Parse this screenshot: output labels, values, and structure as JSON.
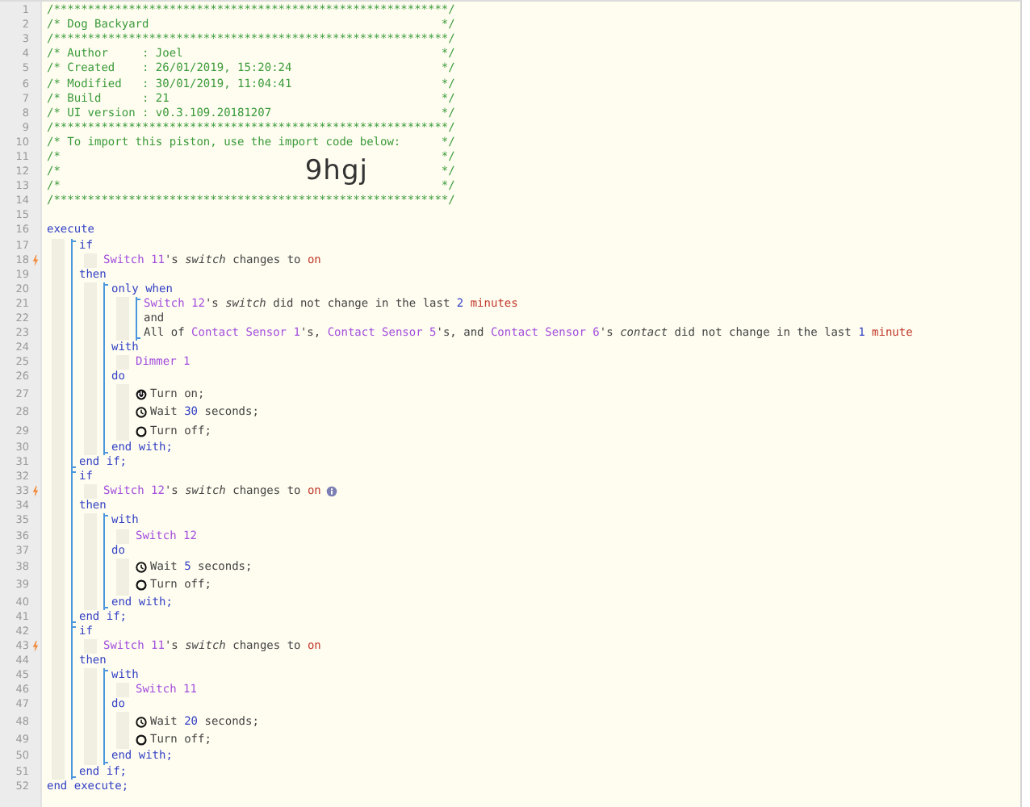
{
  "lines": [
    {
      "number": "1",
      "tokens": [
        {
          "kind": "comment",
          "text": "/**********************************************************/"
        }
      ]
    },
    {
      "number": "2",
      "tokens": [
        {
          "kind": "comment",
          "text": "/* Dog Backyard"
        },
        {
          "kind": "comment",
          "text": " */"
        }
      ]
    },
    {
      "number": "3",
      "tokens": [
        {
          "kind": "comment",
          "text": "/**********************************************************/"
        }
      ]
    },
    {
      "number": "4",
      "tokens": [
        {
          "kind": "comment",
          "text": "/* Author     : Joel"
        },
        {
          "kind": "comment",
          "text": " */"
        }
      ]
    },
    {
      "number": "5",
      "tokens": [
        {
          "kind": "comment",
          "text": "/* Created    : 26/01/2019, 15:20:24"
        },
        {
          "kind": "comment",
          "text": " */"
        }
      ]
    },
    {
      "number": "6",
      "tokens": [
        {
          "kind": "comment",
          "text": "/* Modified   : 30/01/2019, 11:04:41"
        },
        {
          "kind": "comment",
          "text": " */"
        }
      ]
    },
    {
      "number": "7",
      "tokens": [
        {
          "kind": "comment",
          "text": "/* Build      : 21"
        },
        {
          "kind": "comment",
          "text": " */"
        }
      ]
    },
    {
      "number": "8",
      "tokens": [
        {
          "kind": "comment",
          "text": "/* UI version : v0.3.109.20181207"
        },
        {
          "kind": "comment",
          "text": " */"
        }
      ]
    },
    {
      "number": "9",
      "tokens": [
        {
          "kind": "comment",
          "text": "/**********************************************************/"
        }
      ]
    },
    {
      "number": "10",
      "tokens": [
        {
          "kind": "comment",
          "text": "/* To import this piston, use the import code below:"
        },
        {
          "kind": "comment",
          "text": " */"
        }
      ]
    },
    {
      "number": "11",
      "tokens": [
        {
          "kind": "comment",
          "text": "/*"
        },
        {
          "kind": "comment",
          "text": " */"
        }
      ]
    },
    {
      "number": "12",
      "tokens": [
        {
          "kind": "comment",
          "text": "/*"
        },
        {
          "kind": "import_code",
          "text": "9hgj"
        },
        {
          "kind": "comment",
          "text": " */"
        }
      ]
    },
    {
      "number": "13",
      "tokens": [
        {
          "kind": "comment",
          "text": "/*"
        },
        {
          "kind": "comment",
          "text": " */"
        }
      ]
    },
    {
      "number": "14",
      "tokens": [
        {
          "kind": "comment",
          "text": "/**********************************************************/"
        }
      ]
    },
    {
      "number": "15"
    },
    {
      "number": "16",
      "tokens": [
        {
          "kind": "keyword",
          "text": "execute"
        }
      ],
      "children": [
        {
          "kind": "block",
          "items": [
            {
              "number": "17",
              "tokens": [
                {
                  "kind": "keyword",
                  "text": "if"
                }
              ],
              "children": [
                {
                  "number": "18",
                  "trigger": true,
                  "tokens": [
                    {
                      "kind": "device",
                      "text": "Switch 11"
                    },
                    {
                      "kind": "text",
                      "text": "'s "
                    },
                    {
                      "kind": "attribute",
                      "text": "switch"
                    },
                    {
                      "kind": "text",
                      "text": " changes to "
                    },
                    {
                      "kind": "value",
                      "text": "on"
                    }
                  ]
                }
              ]
            },
            {
              "number": "19",
              "tokens": [
                {
                  "kind": "keyword",
                  "text": "then"
                }
              ],
              "children": [
                {
                  "kind": "block",
                  "items": [
                    {
                      "number": "20",
                      "tokens": [
                        {
                          "kind": "keyword",
                          "text": "only when"
                        }
                      ],
                      "children": [
                        {
                          "kind": "block",
                          "items": [
                            {
                              "number": "21",
                              "tokens": [
                                {
                                  "kind": "device",
                                  "text": "Switch 12"
                                },
                                {
                                  "kind": "text",
                                  "text": "'s "
                                },
                                {
                                  "kind": "attribute",
                                  "text": "switch"
                                },
                                {
                                  "kind": "text",
                                  "text": " did not change in the last "
                                },
                                {
                                  "kind": "number",
                                  "text": "2"
                                },
                                {
                                  "kind": "value",
                                  "text": " minutes"
                                }
                              ]
                            },
                            {
                              "number": "22",
                              "tokens": [
                                {
                                  "kind": "text",
                                  "text": "and"
                                }
                              ]
                            },
                            {
                              "number": "23",
                              "tokens": [
                                {
                                  "kind": "text",
                                  "text": "All of "
                                },
                                {
                                  "kind": "device",
                                  "text": "Contact Sensor 1"
                                },
                                {
                                  "kind": "text",
                                  "text": "'s, "
                                },
                                {
                                  "kind": "device",
                                  "text": "Contact Sensor 5"
                                },
                                {
                                  "kind": "text",
                                  "text": "'s, and "
                                },
                                {
                                  "kind": "device",
                                  "text": "Contact Sensor 6"
                                },
                                {
                                  "kind": "text",
                                  "text": "'s "
                                },
                                {
                                  "kind": "attribute",
                                  "text": "contact"
                                },
                                {
                                  "kind": "text",
                                  "text": " did not change in the last "
                                },
                                {
                                  "kind": "number",
                                  "text": "1"
                                },
                                {
                                  "kind": "value",
                                  "text": " minute"
                                }
                              ]
                            }
                          ]
                        }
                      ]
                    },
                    {
                      "number": "24",
                      "tokens": [
                        {
                          "kind": "keyword",
                          "text": "with"
                        }
                      ],
                      "children": [
                        {
                          "number": "25",
                          "tokens": [
                            {
                              "kind": "device",
                              "text": "Dimmer 1"
                            }
                          ]
                        }
                      ]
                    },
                    {
                      "number": "26",
                      "tokens": [
                        {
                          "kind": "keyword",
                          "text": "do"
                        }
                      ],
                      "children": [
                        {
                          "number": "27",
                          "kind": "turn_on",
                          "tokens": [
                            {
                              "kind": "text",
                              "text": "Turn on;"
                            }
                          ]
                        },
                        {
                          "number": "28",
                          "kind": "wait",
                          "tokens": [
                            {
                              "kind": "text",
                              "text": "Wait "
                            },
                            {
                              "kind": "number",
                              "text": "30"
                            },
                            {
                              "kind": "text",
                              "text": " seconds;"
                            }
                          ]
                        },
                        {
                          "number": "29",
                          "kind": "turn_off",
                          "tokens": [
                            {
                              "kind": "text",
                              "text": "Turn off;"
                            }
                          ]
                        }
                      ]
                    },
                    {
                      "number": "30",
                      "tokens": [
                        {
                          "kind": "keyword",
                          "text": "end with;"
                        }
                      ]
                    }
                  ]
                }
              ]
            },
            {
              "number": "31",
              "tokens": [
                {
                  "kind": "keyword",
                  "text": "end if;"
                }
              ]
            }
          ]
        },
        {
          "kind": "block",
          "items": [
            {
              "number": "32",
              "tokens": [
                {
                  "kind": "keyword",
                  "text": "if"
                }
              ],
              "children": [
                {
                  "number": "33",
                  "trigger": true,
                  "info": true,
                  "tokens": [
                    {
                      "kind": "device",
                      "text": "Switch 12"
                    },
                    {
                      "kind": "text",
                      "text": "'s "
                    },
                    {
                      "kind": "attribute",
                      "text": "switch"
                    },
                    {
                      "kind": "text",
                      "text": " changes to "
                    },
                    {
                      "kind": "value",
                      "text": "on"
                    }
                  ]
                }
              ]
            },
            {
              "number": "34",
              "tokens": [
                {
                  "kind": "keyword",
                  "text": "then"
                }
              ],
              "children": [
                {
                  "kind": "block",
                  "items": [
                    {
                      "number": "35",
                      "tokens": [
                        {
                          "kind": "keyword",
                          "text": "with"
                        }
                      ],
                      "children": [
                        {
                          "number": "36",
                          "tokens": [
                            {
                              "kind": "device",
                              "text": "Switch 12"
                            }
                          ]
                        }
                      ]
                    },
                    {
                      "number": "37",
                      "tokens": [
                        {
                          "kind": "keyword",
                          "text": "do"
                        }
                      ],
                      "children": [
                        {
                          "number": "38",
                          "kind": "wait",
                          "tokens": [
                            {
                              "kind": "text",
                              "text": "Wait "
                            },
                            {
                              "kind": "number",
                              "text": "5"
                            },
                            {
                              "kind": "text",
                              "text": " seconds;"
                            }
                          ]
                        },
                        {
                          "number": "39",
                          "kind": "turn_off",
                          "tokens": [
                            {
                              "kind": "text",
                              "text": "Turn off;"
                            }
                          ]
                        }
                      ]
                    },
                    {
                      "number": "40",
                      "tokens": [
                        {
                          "kind": "keyword",
                          "text": "end with;"
                        }
                      ]
                    }
                  ]
                }
              ]
            },
            {
              "number": "41",
              "tokens": [
                {
                  "kind": "keyword",
                  "text": "end if;"
                }
              ]
            }
          ]
        },
        {
          "kind": "block",
          "items": [
            {
              "number": "42",
              "tokens": [
                {
                  "kind": "keyword",
                  "text": "if"
                }
              ],
              "children": [
                {
                  "number": "43",
                  "trigger": true,
                  "tokens": [
                    {
                      "kind": "device",
                      "text": "Switch 11"
                    },
                    {
                      "kind": "text",
                      "text": "'s "
                    },
                    {
                      "kind": "attribute",
                      "text": "switch"
                    },
                    {
                      "kind": "text",
                      "text": " changes to "
                    },
                    {
                      "kind": "value",
                      "text": "on"
                    }
                  ]
                }
              ]
            },
            {
              "number": "44",
              "tokens": [
                {
                  "kind": "keyword",
                  "text": "then"
                }
              ],
              "children": [
                {
                  "kind": "block",
                  "items": [
                    {
                      "number": "45",
                      "tokens": [
                        {
                          "kind": "keyword",
                          "text": "with"
                        }
                      ],
                      "children": [
                        {
                          "number": "46",
                          "tokens": [
                            {
                              "kind": "device",
                              "text": "Switch 11"
                            }
                          ]
                        }
                      ]
                    },
                    {
                      "number": "47",
                      "tokens": [
                        {
                          "kind": "keyword",
                          "text": "do"
                        }
                      ],
                      "children": [
                        {
                          "number": "48",
                          "kind": "wait",
                          "tokens": [
                            {
                              "kind": "text",
                              "text": "Wait "
                            },
                            {
                              "kind": "number",
                              "text": "20"
                            },
                            {
                              "kind": "text",
                              "text": " seconds;"
                            }
                          ]
                        },
                        {
                          "number": "49",
                          "kind": "turn_off",
                          "tokens": [
                            {
                              "kind": "text",
                              "text": "Turn off;"
                            }
                          ]
                        }
                      ]
                    },
                    {
                      "number": "50",
                      "tokens": [
                        {
                          "kind": "keyword",
                          "text": "end with;"
                        }
                      ]
                    }
                  ]
                }
              ]
            },
            {
              "number": "51",
              "tokens": [
                {
                  "kind": "keyword",
                  "text": "end if;"
                }
              ]
            }
          ]
        }
      ]
    },
    {
      "number": "52",
      "tokens": [
        {
          "kind": "keyword",
          "text": "end execute;"
        }
      ]
    }
  ]
}
